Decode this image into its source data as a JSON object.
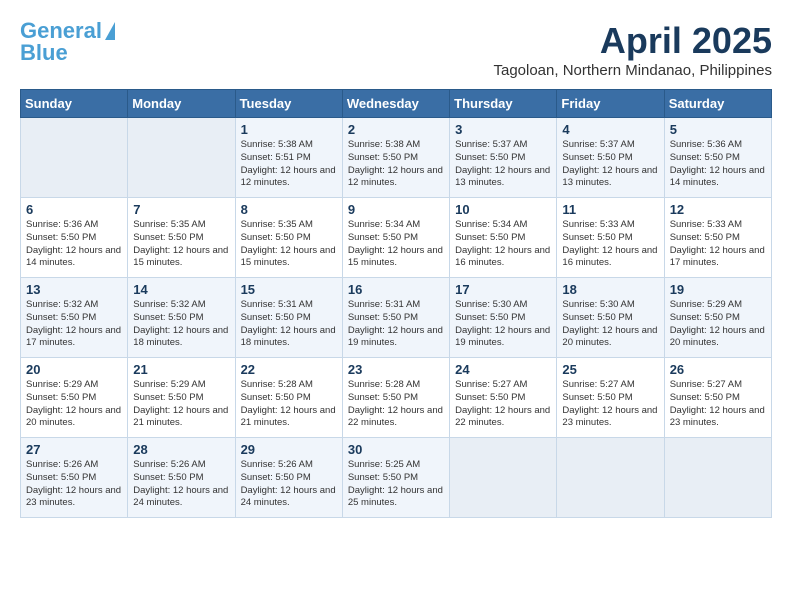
{
  "logo": {
    "line1": "General",
    "line2": "Blue"
  },
  "title": "April 2025",
  "location": "Tagoloan, Northern Mindanao, Philippines",
  "headers": [
    "Sunday",
    "Monday",
    "Tuesday",
    "Wednesday",
    "Thursday",
    "Friday",
    "Saturday"
  ],
  "weeks": [
    [
      {
        "day": "",
        "sunrise": "",
        "sunset": "",
        "daylight": ""
      },
      {
        "day": "",
        "sunrise": "",
        "sunset": "",
        "daylight": ""
      },
      {
        "day": "1",
        "sunrise": "Sunrise: 5:38 AM",
        "sunset": "Sunset: 5:51 PM",
        "daylight": "Daylight: 12 hours and 12 minutes."
      },
      {
        "day": "2",
        "sunrise": "Sunrise: 5:38 AM",
        "sunset": "Sunset: 5:50 PM",
        "daylight": "Daylight: 12 hours and 12 minutes."
      },
      {
        "day": "3",
        "sunrise": "Sunrise: 5:37 AM",
        "sunset": "Sunset: 5:50 PM",
        "daylight": "Daylight: 12 hours and 13 minutes."
      },
      {
        "day": "4",
        "sunrise": "Sunrise: 5:37 AM",
        "sunset": "Sunset: 5:50 PM",
        "daylight": "Daylight: 12 hours and 13 minutes."
      },
      {
        "day": "5",
        "sunrise": "Sunrise: 5:36 AM",
        "sunset": "Sunset: 5:50 PM",
        "daylight": "Daylight: 12 hours and 14 minutes."
      }
    ],
    [
      {
        "day": "6",
        "sunrise": "Sunrise: 5:36 AM",
        "sunset": "Sunset: 5:50 PM",
        "daylight": "Daylight: 12 hours and 14 minutes."
      },
      {
        "day": "7",
        "sunrise": "Sunrise: 5:35 AM",
        "sunset": "Sunset: 5:50 PM",
        "daylight": "Daylight: 12 hours and 15 minutes."
      },
      {
        "day": "8",
        "sunrise": "Sunrise: 5:35 AM",
        "sunset": "Sunset: 5:50 PM",
        "daylight": "Daylight: 12 hours and 15 minutes."
      },
      {
        "day": "9",
        "sunrise": "Sunrise: 5:34 AM",
        "sunset": "Sunset: 5:50 PM",
        "daylight": "Daylight: 12 hours and 15 minutes."
      },
      {
        "day": "10",
        "sunrise": "Sunrise: 5:34 AM",
        "sunset": "Sunset: 5:50 PM",
        "daylight": "Daylight: 12 hours and 16 minutes."
      },
      {
        "day": "11",
        "sunrise": "Sunrise: 5:33 AM",
        "sunset": "Sunset: 5:50 PM",
        "daylight": "Daylight: 12 hours and 16 minutes."
      },
      {
        "day": "12",
        "sunrise": "Sunrise: 5:33 AM",
        "sunset": "Sunset: 5:50 PM",
        "daylight": "Daylight: 12 hours and 17 minutes."
      }
    ],
    [
      {
        "day": "13",
        "sunrise": "Sunrise: 5:32 AM",
        "sunset": "Sunset: 5:50 PM",
        "daylight": "Daylight: 12 hours and 17 minutes."
      },
      {
        "day": "14",
        "sunrise": "Sunrise: 5:32 AM",
        "sunset": "Sunset: 5:50 PM",
        "daylight": "Daylight: 12 hours and 18 minutes."
      },
      {
        "day": "15",
        "sunrise": "Sunrise: 5:31 AM",
        "sunset": "Sunset: 5:50 PM",
        "daylight": "Daylight: 12 hours and 18 minutes."
      },
      {
        "day": "16",
        "sunrise": "Sunrise: 5:31 AM",
        "sunset": "Sunset: 5:50 PM",
        "daylight": "Daylight: 12 hours and 19 minutes."
      },
      {
        "day": "17",
        "sunrise": "Sunrise: 5:30 AM",
        "sunset": "Sunset: 5:50 PM",
        "daylight": "Daylight: 12 hours and 19 minutes."
      },
      {
        "day": "18",
        "sunrise": "Sunrise: 5:30 AM",
        "sunset": "Sunset: 5:50 PM",
        "daylight": "Daylight: 12 hours and 20 minutes."
      },
      {
        "day": "19",
        "sunrise": "Sunrise: 5:29 AM",
        "sunset": "Sunset: 5:50 PM",
        "daylight": "Daylight: 12 hours and 20 minutes."
      }
    ],
    [
      {
        "day": "20",
        "sunrise": "Sunrise: 5:29 AM",
        "sunset": "Sunset: 5:50 PM",
        "daylight": "Daylight: 12 hours and 20 minutes."
      },
      {
        "day": "21",
        "sunrise": "Sunrise: 5:29 AM",
        "sunset": "Sunset: 5:50 PM",
        "daylight": "Daylight: 12 hours and 21 minutes."
      },
      {
        "day": "22",
        "sunrise": "Sunrise: 5:28 AM",
        "sunset": "Sunset: 5:50 PM",
        "daylight": "Daylight: 12 hours and 21 minutes."
      },
      {
        "day": "23",
        "sunrise": "Sunrise: 5:28 AM",
        "sunset": "Sunset: 5:50 PM",
        "daylight": "Daylight: 12 hours and 22 minutes."
      },
      {
        "day": "24",
        "sunrise": "Sunrise: 5:27 AM",
        "sunset": "Sunset: 5:50 PM",
        "daylight": "Daylight: 12 hours and 22 minutes."
      },
      {
        "day": "25",
        "sunrise": "Sunrise: 5:27 AM",
        "sunset": "Sunset: 5:50 PM",
        "daylight": "Daylight: 12 hours and 23 minutes."
      },
      {
        "day": "26",
        "sunrise": "Sunrise: 5:27 AM",
        "sunset": "Sunset: 5:50 PM",
        "daylight": "Daylight: 12 hours and 23 minutes."
      }
    ],
    [
      {
        "day": "27",
        "sunrise": "Sunrise: 5:26 AM",
        "sunset": "Sunset: 5:50 PM",
        "daylight": "Daylight: 12 hours and 23 minutes."
      },
      {
        "day": "28",
        "sunrise": "Sunrise: 5:26 AM",
        "sunset": "Sunset: 5:50 PM",
        "daylight": "Daylight: 12 hours and 24 minutes."
      },
      {
        "day": "29",
        "sunrise": "Sunrise: 5:26 AM",
        "sunset": "Sunset: 5:50 PM",
        "daylight": "Daylight: 12 hours and 24 minutes."
      },
      {
        "day": "30",
        "sunrise": "Sunrise: 5:25 AM",
        "sunset": "Sunset: 5:50 PM",
        "daylight": "Daylight: 12 hours and 25 minutes."
      },
      {
        "day": "",
        "sunrise": "",
        "sunset": "",
        "daylight": ""
      },
      {
        "day": "",
        "sunrise": "",
        "sunset": "",
        "daylight": ""
      },
      {
        "day": "",
        "sunrise": "",
        "sunset": "",
        "daylight": ""
      }
    ]
  ]
}
